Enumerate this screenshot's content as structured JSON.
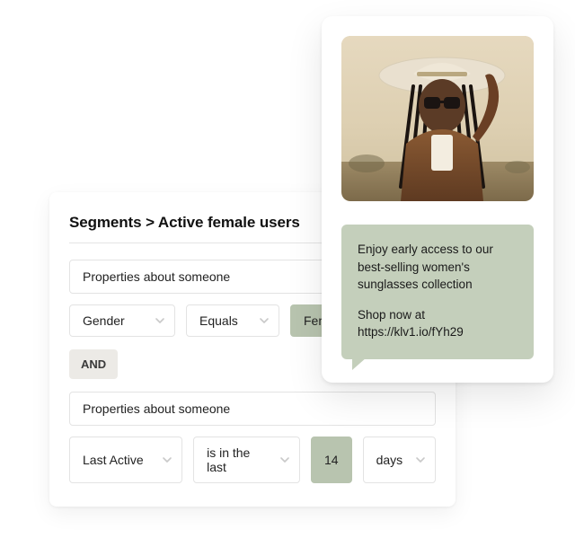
{
  "breadcrumb": {
    "root": "Segments",
    "sep": ">",
    "current": "Active female users"
  },
  "segments": {
    "conditions": [
      {
        "type_label": "Properties about someone",
        "field": "Gender",
        "operator": "Equals",
        "value": "Female"
      },
      {
        "type_label": "Properties about someone",
        "field": "Last Active",
        "operator": "is in the last",
        "value": "14",
        "unit": "days"
      }
    ],
    "conjunction": "AND"
  },
  "message": {
    "body_line1": "Enjoy early access to our best-selling women's sunglasses collection",
    "body_line2": "Shop now at https://klv1.io/fYh29"
  }
}
